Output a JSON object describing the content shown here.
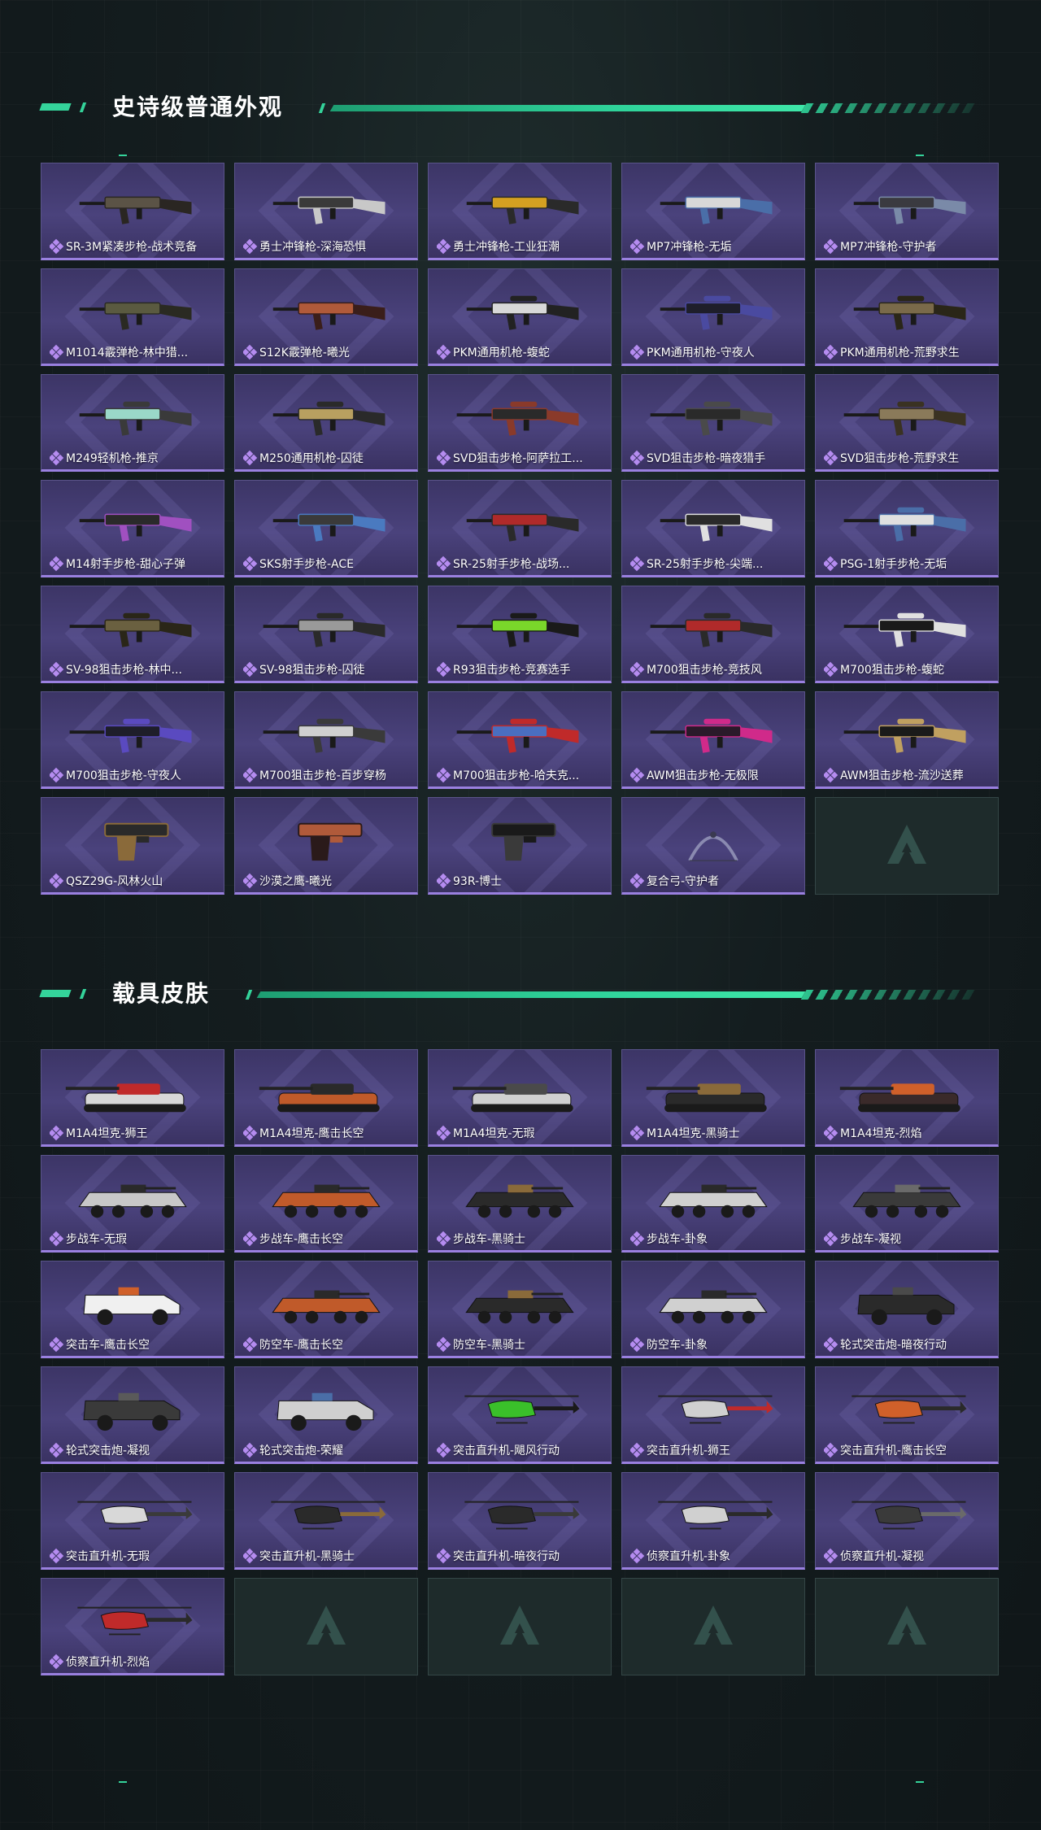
{
  "sections": [
    {
      "title": "史诗级普通外观",
      "items": [
        {
          "label": "SR-3M紧凑步枪-战术竞备",
          "kind": "rifle",
          "colors": [
            "#5b5346",
            "#2a2622"
          ]
        },
        {
          "label": "勇士冲锋枪-深海恐惧",
          "kind": "smg",
          "colors": [
            "#3a3a3a",
            "#c8c8c8"
          ]
        },
        {
          "label": "勇士冲锋枪-工业狂潮",
          "kind": "smg",
          "colors": [
            "#d4a021",
            "#2a2a2a"
          ]
        },
        {
          "label": "MP7冲锋枪-无垢",
          "kind": "smg",
          "colors": [
            "#d8d8d8",
            "#4a6ea8"
          ]
        },
        {
          "label": "MP7冲锋枪-守护者",
          "kind": "smg",
          "colors": [
            "#3a3a40",
            "#7a8aa8"
          ]
        },
        {
          "label": "M1014霰弹枪-林中猎...",
          "kind": "shotgun",
          "colors": [
            "#5a5a40",
            "#2a2a22"
          ]
        },
        {
          "label": "S12K霰弹枪-曦光",
          "kind": "rifle",
          "colors": [
            "#b05a3a",
            "#3a1e1a"
          ]
        },
        {
          "label": "PKM通用机枪-蝮蛇",
          "kind": "mg",
          "colors": [
            "#d8d8d8",
            "#222222"
          ]
        },
        {
          "label": "PKM通用机枪-守夜人",
          "kind": "mg",
          "colors": [
            "#1e1e2a",
            "#4a4aa0"
          ]
        },
        {
          "label": "PKM通用机枪-荒野求生",
          "kind": "mg",
          "colors": [
            "#7a6a4a",
            "#2a2618"
          ]
        },
        {
          "label": "M249轻机枪-推京",
          "kind": "mg",
          "colors": [
            "#9ad8c8",
            "#3a3a3a"
          ]
        },
        {
          "label": "M250通用机枪-囚徒",
          "kind": "mg",
          "colors": [
            "#b8a060",
            "#2a2a2a"
          ]
        },
        {
          "label": "SVD狙击步枪-阿萨拉工...",
          "kind": "sniper",
          "colors": [
            "#2a2a2a",
            "#8a3a2a"
          ]
        },
        {
          "label": "SVD狙击步枪-暗夜猎手",
          "kind": "sniper",
          "colors": [
            "#2a2a2a",
            "#4a4a4a"
          ]
        },
        {
          "label": "SVD狙击步枪-荒野求生",
          "kind": "sniper",
          "colors": [
            "#8a7a5a",
            "#3a3222"
          ]
        },
        {
          "label": "M14射手步枪-甜心子弹",
          "kind": "rifle",
          "colors": [
            "#2a2a2a",
            "#a050c0"
          ]
        },
        {
          "label": "SKS射手步枪-ACE",
          "kind": "rifle",
          "colors": [
            "#3a3a3a",
            "#4a7ac0"
          ]
        },
        {
          "label": "SR-25射手步枪-战场...",
          "kind": "rifle",
          "colors": [
            "#b02a2a",
            "#2a2a2a"
          ]
        },
        {
          "label": "SR-25射手步枪-尖端...",
          "kind": "rifle",
          "colors": [
            "#2a2a2a",
            "#e0e0e0"
          ]
        },
        {
          "label": "PSG-1射手步枪-无垢",
          "kind": "sniper",
          "colors": [
            "#e0e0e0",
            "#4a6ea8"
          ]
        },
        {
          "label": "SV-98狙击步枪-林中...",
          "kind": "sniper",
          "colors": [
            "#6a6040",
            "#2a2618"
          ]
        },
        {
          "label": "SV-98狙击步枪-囚徒",
          "kind": "sniper",
          "colors": [
            "#9a9a9a",
            "#2a2a2a"
          ]
        },
        {
          "label": "R93狙击步枪-竞赛选手",
          "kind": "sniper",
          "colors": [
            "#7ad82a",
            "#1a1a1a"
          ]
        },
        {
          "label": "M700狙击步枪-竞技风",
          "kind": "sniper",
          "colors": [
            "#b02a2a",
            "#2a2a2a"
          ]
        },
        {
          "label": "M700狙击步枪-蝮蛇",
          "kind": "sniper",
          "colors": [
            "#1a1a1a",
            "#e0e0e0"
          ]
        },
        {
          "label": "M700狙击步枪-守夜人",
          "kind": "sniper",
          "colors": [
            "#1e1e2a",
            "#5a4ac0"
          ]
        },
        {
          "label": "M700狙击步枪-百步穿杨",
          "kind": "sniper",
          "colors": [
            "#d0d0d0",
            "#3a3a3a"
          ]
        },
        {
          "label": "M700狙击步枪-哈夫克...",
          "kind": "sniper",
          "colors": [
            "#4a6ec0",
            "#c02a2a"
          ]
        },
        {
          "label": "AWM狙击步枪-无极限",
          "kind": "sniper",
          "colors": [
            "#2a1a2a",
            "#d02a8a"
          ]
        },
        {
          "label": "AWM狙击步枪-流沙送葬",
          "kind": "sniper",
          "colors": [
            "#1a1a1a",
            "#c0a060"
          ]
        },
        {
          "label": "QSZ29G-风林火山",
          "kind": "pistol",
          "colors": [
            "#2a2a2a",
            "#8a6a3a"
          ]
        },
        {
          "label": "沙漠之鹰-曦光",
          "kind": "pistol",
          "colors": [
            "#b05a3a",
            "#2a1a1a"
          ]
        },
        {
          "label": "93R-博士",
          "kind": "pistol",
          "colors": [
            "#1a1a1a",
            "#3a3a3a"
          ]
        },
        {
          "label": "复合弓-守护者",
          "kind": "bow",
          "colors": [
            "#8a8ab0",
            "#3a3a50"
          ]
        },
        {
          "label": "",
          "kind": "empty"
        }
      ]
    },
    {
      "title": "载具皮肤",
      "items": [
        {
          "label": "M1A4坦克-狮王",
          "kind": "tank",
          "colors": [
            "#d8d8d8",
            "#c02a2a"
          ]
        },
        {
          "label": "M1A4坦克-鹰击长空",
          "kind": "tank",
          "colors": [
            "#c05a2a",
            "#2a2a2a"
          ]
        },
        {
          "label": "M1A4坦克-无瑕",
          "kind": "tank",
          "colors": [
            "#d0d0d0",
            "#4a4a4a"
          ]
        },
        {
          "label": "M1A4坦克-黑骑士",
          "kind": "tank",
          "colors": [
            "#2a2a2a",
            "#8a6a3a"
          ]
        },
        {
          "label": "M1A4坦克-烈焰",
          "kind": "tank",
          "colors": [
            "#3a2a2a",
            "#d0602a"
          ]
        },
        {
          "label": "步战车-无瑕",
          "kind": "ifv",
          "colors": [
            "#c8c8c8",
            "#2a2a2a"
          ]
        },
        {
          "label": "步战车-鹰击长空",
          "kind": "ifv",
          "colors": [
            "#c05a2a",
            "#2a2a2a"
          ]
        },
        {
          "label": "步战车-黑骑士",
          "kind": "ifv",
          "colors": [
            "#2a2a2a",
            "#8a6a3a"
          ]
        },
        {
          "label": "步战车-卦象",
          "kind": "ifv",
          "colors": [
            "#d0d0d0",
            "#2a2a2a"
          ]
        },
        {
          "label": "步战车-凝视",
          "kind": "ifv",
          "colors": [
            "#3a3a3a",
            "#6a6a6a"
          ]
        },
        {
          "label": "突击车-鹰击长空",
          "kind": "truck",
          "colors": [
            "#f0f0f0",
            "#d0602a"
          ]
        },
        {
          "label": "防空车-鹰击长空",
          "kind": "ifv",
          "colors": [
            "#c05a2a",
            "#2a2a2a"
          ]
        },
        {
          "label": "防空车-黑骑士",
          "kind": "ifv",
          "colors": [
            "#2a2a2a",
            "#8a6a3a"
          ]
        },
        {
          "label": "防空车-卦象",
          "kind": "ifv",
          "colors": [
            "#d0d0d0",
            "#2a2a2a"
          ]
        },
        {
          "label": "轮式突击炮-暗夜行动",
          "kind": "truck",
          "colors": [
            "#2a2a2a",
            "#4a4a4a"
          ]
        },
        {
          "label": "轮式突击炮-凝视",
          "kind": "truck",
          "colors": [
            "#3a3a3a",
            "#5a5a5a"
          ]
        },
        {
          "label": "轮式突击炮-荣耀",
          "kind": "truck",
          "colors": [
            "#d0d0d0",
            "#4a6ea8"
          ]
        },
        {
          "label": "突击直升机-飓风行动",
          "kind": "heli",
          "colors": [
            "#3ac02a",
            "#1a1a1a"
          ]
        },
        {
          "label": "突击直升机-狮王",
          "kind": "heli",
          "colors": [
            "#d0d0d0",
            "#c02a2a"
          ]
        },
        {
          "label": "突击直升机-鹰击长空",
          "kind": "heli",
          "colors": [
            "#d0602a",
            "#2a2a2a"
          ]
        },
        {
          "label": "突击直升机-无瑕",
          "kind": "heli",
          "colors": [
            "#d8d8d8",
            "#3a3a3a"
          ]
        },
        {
          "label": "突击直升机-黑骑士",
          "kind": "heli",
          "colors": [
            "#2a2a2a",
            "#8a6a3a"
          ]
        },
        {
          "label": "突击直升机-暗夜行动",
          "kind": "heli",
          "colors": [
            "#2a2a2a",
            "#3a3a3a"
          ]
        },
        {
          "label": "侦察直升机-卦象",
          "kind": "heli",
          "colors": [
            "#d0d0d0",
            "#2a2a2a"
          ]
        },
        {
          "label": "侦察直升机-凝视",
          "kind": "heli",
          "colors": [
            "#3a3a3a",
            "#6a6a6a"
          ]
        },
        {
          "label": "侦察直升机-烈焰",
          "kind": "heli",
          "colors": [
            "#c02a2a",
            "#2a2a2a"
          ]
        },
        {
          "label": "",
          "kind": "empty"
        },
        {
          "label": "",
          "kind": "empty"
        },
        {
          "label": "",
          "kind": "empty"
        },
        {
          "label": "",
          "kind": "empty"
        }
      ]
    }
  ]
}
